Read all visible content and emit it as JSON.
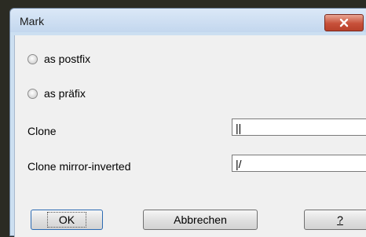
{
  "dialog": {
    "title": "Mark",
    "close_icon": "close-x-icon",
    "close_color": "#c7503a"
  },
  "options": {
    "postfix_label": "as postfix",
    "prefix_label": "as präfix",
    "postfix_selected": false,
    "prefix_selected": false
  },
  "fields": {
    "clone_label": "Clone",
    "clone_value": "||",
    "clone_mirror_label": "Clone mirror-inverted",
    "clone_mirror_value": "|/"
  },
  "buttons": {
    "ok_label": "OK",
    "cancel_label": "Abbrechen",
    "help_label": "?"
  }
}
